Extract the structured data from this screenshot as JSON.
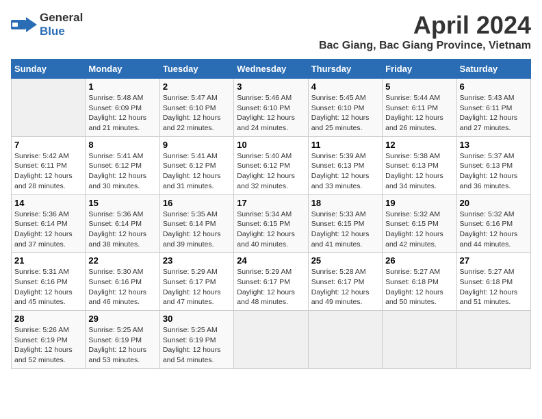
{
  "logo": {
    "general": "General",
    "blue": "Blue"
  },
  "title": "April 2024",
  "location": "Bac Giang, Bac Giang Province, Vietnam",
  "days_of_week": [
    "Sunday",
    "Monday",
    "Tuesday",
    "Wednesday",
    "Thursday",
    "Friday",
    "Saturday"
  ],
  "weeks": [
    [
      {
        "day": "",
        "empty": true
      },
      {
        "day": "1",
        "sunrise": "5:48 AM",
        "sunset": "6:09 PM",
        "daylight": "12 hours and 21 minutes."
      },
      {
        "day": "2",
        "sunrise": "5:47 AM",
        "sunset": "6:10 PM",
        "daylight": "12 hours and 22 minutes."
      },
      {
        "day": "3",
        "sunrise": "5:46 AM",
        "sunset": "6:10 PM",
        "daylight": "12 hours and 24 minutes."
      },
      {
        "day": "4",
        "sunrise": "5:45 AM",
        "sunset": "6:10 PM",
        "daylight": "12 hours and 25 minutes."
      },
      {
        "day": "5",
        "sunrise": "5:44 AM",
        "sunset": "6:11 PM",
        "daylight": "12 hours and 26 minutes."
      },
      {
        "day": "6",
        "sunrise": "5:43 AM",
        "sunset": "6:11 PM",
        "daylight": "12 hours and 27 minutes."
      }
    ],
    [
      {
        "day": "7",
        "sunrise": "5:42 AM",
        "sunset": "6:11 PM",
        "daylight": "12 hours and 28 minutes."
      },
      {
        "day": "8",
        "sunrise": "5:41 AM",
        "sunset": "6:12 PM",
        "daylight": "12 hours and 30 minutes."
      },
      {
        "day": "9",
        "sunrise": "5:41 AM",
        "sunset": "6:12 PM",
        "daylight": "12 hours and 31 minutes."
      },
      {
        "day": "10",
        "sunrise": "5:40 AM",
        "sunset": "6:12 PM",
        "daylight": "12 hours and 32 minutes."
      },
      {
        "day": "11",
        "sunrise": "5:39 AM",
        "sunset": "6:13 PM",
        "daylight": "12 hours and 33 minutes."
      },
      {
        "day": "12",
        "sunrise": "5:38 AM",
        "sunset": "6:13 PM",
        "daylight": "12 hours and 34 minutes."
      },
      {
        "day": "13",
        "sunrise": "5:37 AM",
        "sunset": "6:13 PM",
        "daylight": "12 hours and 36 minutes."
      }
    ],
    [
      {
        "day": "14",
        "sunrise": "5:36 AM",
        "sunset": "6:14 PM",
        "daylight": "12 hours and 37 minutes."
      },
      {
        "day": "15",
        "sunrise": "5:36 AM",
        "sunset": "6:14 PM",
        "daylight": "12 hours and 38 minutes."
      },
      {
        "day": "16",
        "sunrise": "5:35 AM",
        "sunset": "6:14 PM",
        "daylight": "12 hours and 39 minutes."
      },
      {
        "day": "17",
        "sunrise": "5:34 AM",
        "sunset": "6:15 PM",
        "daylight": "12 hours and 40 minutes."
      },
      {
        "day": "18",
        "sunrise": "5:33 AM",
        "sunset": "6:15 PM",
        "daylight": "12 hours and 41 minutes."
      },
      {
        "day": "19",
        "sunrise": "5:32 AM",
        "sunset": "6:15 PM",
        "daylight": "12 hours and 42 minutes."
      },
      {
        "day": "20",
        "sunrise": "5:32 AM",
        "sunset": "6:16 PM",
        "daylight": "12 hours and 44 minutes."
      }
    ],
    [
      {
        "day": "21",
        "sunrise": "5:31 AM",
        "sunset": "6:16 PM",
        "daylight": "12 hours and 45 minutes."
      },
      {
        "day": "22",
        "sunrise": "5:30 AM",
        "sunset": "6:16 PM",
        "daylight": "12 hours and 46 minutes."
      },
      {
        "day": "23",
        "sunrise": "5:29 AM",
        "sunset": "6:17 PM",
        "daylight": "12 hours and 47 minutes."
      },
      {
        "day": "24",
        "sunrise": "5:29 AM",
        "sunset": "6:17 PM",
        "daylight": "12 hours and 48 minutes."
      },
      {
        "day": "25",
        "sunrise": "5:28 AM",
        "sunset": "6:17 PM",
        "daylight": "12 hours and 49 minutes."
      },
      {
        "day": "26",
        "sunrise": "5:27 AM",
        "sunset": "6:18 PM",
        "daylight": "12 hours and 50 minutes."
      },
      {
        "day": "27",
        "sunrise": "5:27 AM",
        "sunset": "6:18 PM",
        "daylight": "12 hours and 51 minutes."
      }
    ],
    [
      {
        "day": "28",
        "sunrise": "5:26 AM",
        "sunset": "6:19 PM",
        "daylight": "12 hours and 52 minutes."
      },
      {
        "day": "29",
        "sunrise": "5:25 AM",
        "sunset": "6:19 PM",
        "daylight": "12 hours and 53 minutes."
      },
      {
        "day": "30",
        "sunrise": "5:25 AM",
        "sunset": "6:19 PM",
        "daylight": "12 hours and 54 minutes."
      },
      {
        "day": "",
        "empty": true
      },
      {
        "day": "",
        "empty": true
      },
      {
        "day": "",
        "empty": true
      },
      {
        "day": "",
        "empty": true
      }
    ]
  ],
  "labels": {
    "sunrise": "Sunrise: ",
    "sunset": "Sunset: ",
    "daylight": "Daylight: "
  }
}
